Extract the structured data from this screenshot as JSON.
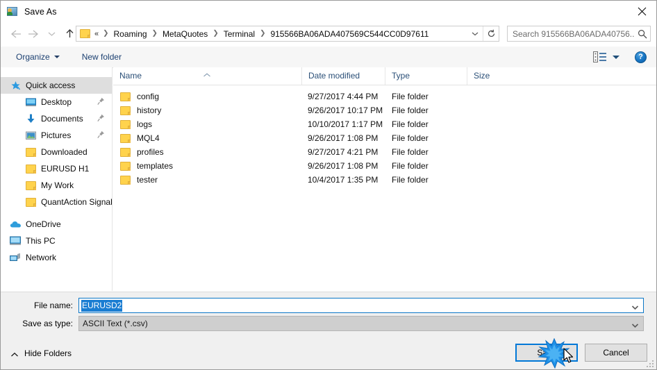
{
  "window": {
    "title": "Save As",
    "app_icon": "photo-person-icon",
    "close_label": "✕"
  },
  "nav": {
    "back_icon": "arrow-left-icon",
    "forward_icon": "arrow-right-icon",
    "recent_icon": "chevron-down-icon",
    "up_icon": "arrow-up-icon"
  },
  "address": {
    "folder_icon": "folder-icon",
    "overflow": "«",
    "crumbs": [
      "Roaming",
      "MetaQuotes",
      "Terminal",
      "915566BA06ADA407569C544CC0D97611"
    ],
    "separator": "❯",
    "dropdown_icon": "chevron-down-icon",
    "refresh_icon": "refresh-icon"
  },
  "search": {
    "placeholder": "Search 915566BA06ADA40756...",
    "icon": "search-icon"
  },
  "toolbar": {
    "organize": "Organize",
    "new_folder": "New folder",
    "view_icon": "view-layout-icon",
    "view_caret_icon": "chevron-down-icon",
    "help_icon": "help-icon",
    "help_label": "?"
  },
  "sidebar": {
    "items": [
      {
        "label": "Quick access",
        "icon": "star-pin-icon",
        "level": "root",
        "selected": true,
        "pinned": false
      },
      {
        "label": "Desktop",
        "icon": "monitor-icon",
        "level": "1",
        "selected": false,
        "pinned": true
      },
      {
        "label": "Documents",
        "icon": "download-icon",
        "level": "1",
        "selected": false,
        "pinned": true
      },
      {
        "label": "Pictures",
        "icon": "picture-icon",
        "level": "1",
        "selected": false,
        "pinned": true
      },
      {
        "label": "Downloaded",
        "icon": "folder-icon",
        "level": "1",
        "selected": false,
        "pinned": false
      },
      {
        "label": "EURUSD H1",
        "icon": "folder-icon",
        "level": "1",
        "selected": false,
        "pinned": false
      },
      {
        "label": "My Work",
        "icon": "folder-icon",
        "level": "1",
        "selected": false,
        "pinned": false
      },
      {
        "label": "QuantAction Signal",
        "icon": "folder-icon",
        "level": "1",
        "selected": false,
        "pinned": false
      },
      {
        "label": "OneDrive",
        "icon": "cloud-icon",
        "level": "root",
        "selected": false,
        "pinned": false
      },
      {
        "label": "This PC",
        "icon": "computer-icon",
        "level": "root",
        "selected": false,
        "pinned": false
      },
      {
        "label": "Network",
        "icon": "network-icon",
        "level": "root",
        "selected": false,
        "pinned": false
      }
    ]
  },
  "filelist": {
    "columns": [
      "Name",
      "Date modified",
      "Type",
      "Size"
    ],
    "sort_column": "Name",
    "sort_direction": "ascending",
    "rows": [
      {
        "name": "config",
        "date": "9/27/2017 4:44 PM",
        "type": "File folder",
        "size": ""
      },
      {
        "name": "history",
        "date": "9/26/2017 10:17 PM",
        "type": "File folder",
        "size": ""
      },
      {
        "name": "logs",
        "date": "10/10/2017 1:17 PM",
        "type": "File folder",
        "size": ""
      },
      {
        "name": "MQL4",
        "date": "9/26/2017 1:08 PM",
        "type": "File folder",
        "size": ""
      },
      {
        "name": "profiles",
        "date": "9/27/2017 4:21 PM",
        "type": "File folder",
        "size": ""
      },
      {
        "name": "templates",
        "date": "9/26/2017 1:08 PM",
        "type": "File folder",
        "size": ""
      },
      {
        "name": "tester",
        "date": "10/4/2017 1:35 PM",
        "type": "File folder",
        "size": ""
      }
    ]
  },
  "form": {
    "filename_label": "File name:",
    "filename_value": "EURUSD2",
    "filetype_label": "Save as type:",
    "filetype_value": "ASCII Text (*.csv)",
    "dropdown_icon": "chevron-down-icon"
  },
  "footer": {
    "hide_folders": "Hide Folders",
    "hide_folders_icon": "chevron-up-icon",
    "save_label": "Save",
    "cancel_label": "Cancel",
    "click_indicator": "click-burst",
    "cursor": "mouse-pointer"
  },
  "colors": {
    "accent": "#0078d7",
    "folder": "#ffd34d",
    "selection": "#1a7dd2",
    "toolbar_text": "#1b3f70",
    "header_text": "#2a4f77"
  }
}
